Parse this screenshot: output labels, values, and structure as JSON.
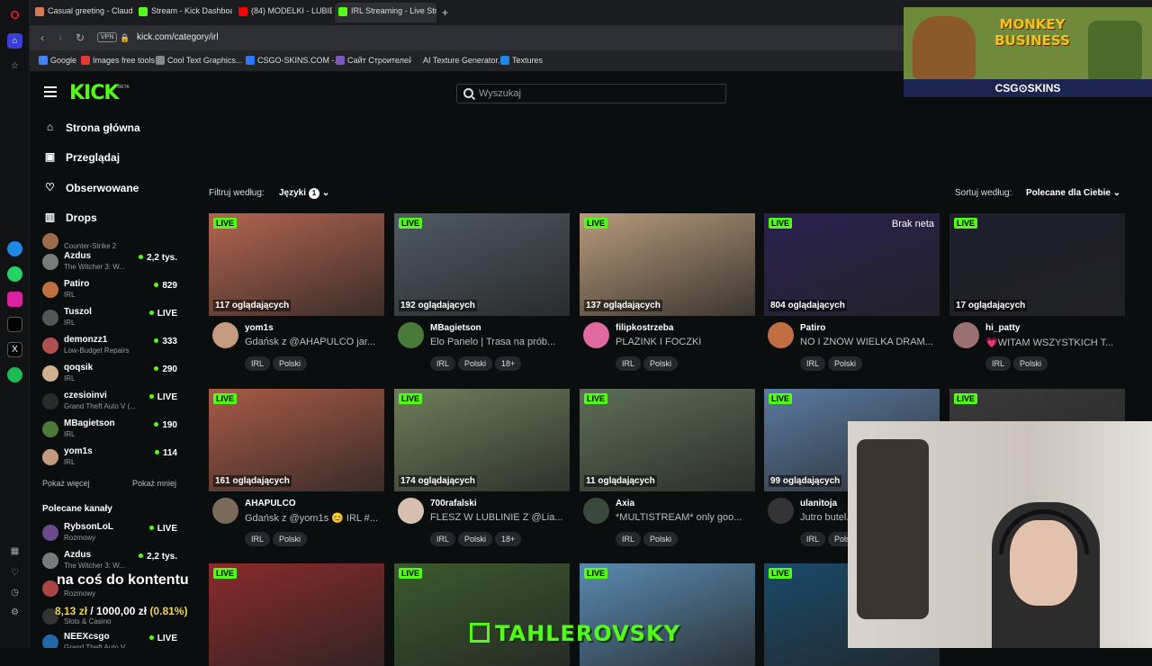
{
  "tabs": [
    {
      "label": "Casual greeting - Claude",
      "color": "#d97757"
    },
    {
      "label": "Stream - Kick Dashboard",
      "color": "#53fc18"
    },
    {
      "label": "(84) MODELKI - LUBIĘ CI",
      "color": "#ff0000"
    },
    {
      "label": "IRL Streaming - Live Strea",
      "color": "#53fc18",
      "active": true
    }
  ],
  "address": {
    "vpn": "VPN",
    "url": "kick.com/category/irl"
  },
  "bookmarks": [
    {
      "label": "Google",
      "color": "#4285f4"
    },
    {
      "label": "Images free tools",
      "color": "#e53935"
    },
    {
      "label": "Cool Text Graphics...",
      "color": "#888"
    },
    {
      "label": "CSGO-SKINS.COM -...",
      "color": "#2979ff"
    },
    {
      "label": "Сайт Строителей",
      "color": "#7e57c2"
    },
    {
      "label": "AI Texture Generator...",
      "color": "#222"
    },
    {
      "label": "Textures",
      "color": "#1e88e5"
    }
  ],
  "header": {
    "logo": "KICK",
    "beta": "BETA",
    "search_placeholder": "Wyszukaj"
  },
  "nav": [
    {
      "label": "Strona główna",
      "icon": "home-icon",
      "glyph": "⌂"
    },
    {
      "label": "Przeglądaj",
      "icon": "browse-icon",
      "glyph": "▣"
    },
    {
      "label": "Obserwowane",
      "icon": "heart-icon",
      "glyph": "♡"
    },
    {
      "label": "Drops",
      "icon": "drops-icon",
      "glyph": "▥"
    }
  ],
  "followed": [
    {
      "name": "",
      "category": "Counter-Strike 2",
      "viewers": "",
      "color": "#9c6b4a"
    },
    {
      "name": "Azdus",
      "category": "The Witcher 3: W...",
      "viewers": "2,2 tys.",
      "color": "#7a7a7a"
    },
    {
      "name": "Patiro",
      "category": "IRL",
      "viewers": "829",
      "color": "#c07040"
    },
    {
      "name": "Tuszol",
      "category": "IRL",
      "viewers": "LIVE",
      "color": "#555"
    },
    {
      "name": "demonzz1",
      "category": "Low-Budget Repairs",
      "viewers": "333",
      "color": "#b05050"
    },
    {
      "name": "qoqsik",
      "category": "IRL",
      "viewers": "290",
      "color": "#d0b090"
    },
    {
      "name": "czesioinvi",
      "category": "Grand Theft Auto V (...",
      "viewers": "LIVE",
      "color": "#2a2a2a"
    },
    {
      "name": "MBagietson",
      "category": "IRL",
      "viewers": "190",
      "color": "#4a7a3a"
    },
    {
      "name": "yom1s",
      "category": "IRL",
      "viewers": "114",
      "color": "#c49a80"
    }
  ],
  "sidebar_links": {
    "more": "Pokaż więcej",
    "less": "Pokaż mniej"
  },
  "recommended_title": "Polecane kanały",
  "recommended": [
    {
      "name": "RybsonLoL",
      "category": "Rozmowy",
      "viewers": "LIVE",
      "color": "#6a4a8a"
    },
    {
      "name": "Azdus",
      "category": "The Witcher 3: W...",
      "viewers": "2,2 tys.",
      "color": "#7a7a7a"
    },
    {
      "name": "",
      "category": "Rozmowy",
      "viewers": "",
      "color": "#aa4444"
    },
    {
      "name": "",
      "category": "Slots & Casino",
      "viewers": "",
      "color": "#333"
    },
    {
      "name": "NEEXcsgo",
      "category": "Grand Theft Auto V...",
      "viewers": "LIVE",
      "color": "#2266aa"
    }
  ],
  "filter": {
    "label": "Filtruj według:",
    "button": "Języki",
    "count": "1"
  },
  "sort": {
    "label": "Sortuj według:",
    "button": "Polecane dla Ciebie"
  },
  "live_label": "LIVE",
  "cards": [
    {
      "viewers": "117 oglądających",
      "name": "yom1s",
      "title": "Gdańsk z @AHAPULCO jar...",
      "tags": [
        "IRL",
        "Polski"
      ],
      "bg": "#b3644f",
      "av": "#c49a80"
    },
    {
      "viewers": "192 oglądających",
      "name": "MBagietson",
      "title": "Elo Panelo | Trasa na prób...",
      "tags": [
        "IRL",
        "Polski",
        "18+"
      ],
      "bg": "#4f5a63",
      "av": "#4a7a3a"
    },
    {
      "viewers": "137 oglądających",
      "name": "filipkostrzeba",
      "title": "PLAŻINK I FOCZKI",
      "tags": [
        "IRL",
        "Polski"
      ],
      "bg": "#b79a7a",
      "av": "#e06aa0"
    },
    {
      "viewers": "804 oglądających",
      "name": "Patiro",
      "title": "NO I ZNÓW WIELKA DRAM...",
      "tags": [
        "IRL",
        "Polski"
      ],
      "bg": "#2a2150",
      "av": "#c07040",
      "overlay": "Brak neta"
    },
    {
      "viewers": "17 oglądających",
      "name": "hi_patty",
      "title": "💗WITAM WSZYSTKICH T...",
      "tags": [
        "IRL",
        "Polski"
      ],
      "bg": "#1d1f2a",
      "av": "#9a7070"
    },
    {
      "viewers": "161 oglądających",
      "name": "AHAPULCO",
      "title": "Gdańsk z @yom1s 😊 IRL #...",
      "tags": [
        "IRL",
        "Polski"
      ],
      "bg": "#a85a46",
      "av": "#7a6a5a"
    },
    {
      "viewers": "174 oglądających",
      "name": "700rafalski",
      "title": "FLESZ W LUBLINIE Z @Lia...",
      "tags": [
        "IRL",
        "Polski",
        "18+"
      ],
      "bg": "#6d7e5a",
      "av": "#d8c0b0"
    },
    {
      "viewers": "11 oglądających",
      "name": "Axia",
      "title": "*MULTISTREAM* only goo...",
      "tags": [
        "IRL",
        "Polski"
      ],
      "bg": "#5e6e56",
      "av": "#3a4a3a"
    },
    {
      "viewers": "99 oglądających",
      "name": "ulanitoja",
      "title": "Jutro butel...",
      "tags": [
        "IRL",
        "Polski"
      ],
      "bg": "#5a7aa0",
      "av": "#333"
    },
    {
      "viewers": "",
      "name": "",
      "title": "",
      "tags": [],
      "bg": "#3a3a3a",
      "av": "#333"
    },
    {
      "viewers": "",
      "name": "",
      "title": "",
      "tags": [],
      "bg": "#8a2a2a",
      "av": "#333"
    },
    {
      "viewers": "",
      "name": "",
      "title": "",
      "tags": [],
      "bg": "#3b5a2e",
      "av": "#333"
    },
    {
      "viewers": "",
      "name": "",
      "title": "",
      "tags": [],
      "bg": "#5a8ab0",
      "av": "#333"
    },
    {
      "viewers": "",
      "name": "",
      "title": "",
      "tags": [],
      "bg": "#1a4a6a",
      "av": "#333"
    }
  ],
  "ad": {
    "title": "MONKEY BUSINESS",
    "brand": "CSG⊙SKINS"
  },
  "stream_overlay": {
    "text": "na coś do kontentu",
    "donation_amount": "8,13 zł",
    "donation_goal": "/ 1000,00 zł",
    "donation_pct": "(0.81%)",
    "banner": "TAHLEROVSKY"
  }
}
